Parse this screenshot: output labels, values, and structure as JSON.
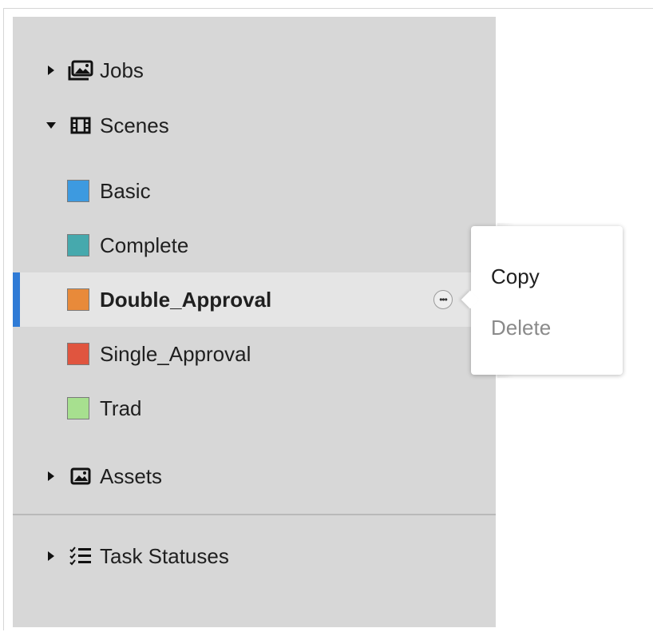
{
  "tree": {
    "jobs": {
      "label": "Jobs",
      "icon": "images-icon",
      "expanded": false
    },
    "scenes": {
      "label": "Scenes",
      "icon": "film-icon",
      "expanded": true,
      "items": [
        {
          "label": "Basic",
          "color": "#3d9ae0",
          "selected": false
        },
        {
          "label": "Complete",
          "color": "#46a9ad",
          "selected": false
        },
        {
          "label": "Double_Approval",
          "color": "#e88a3a",
          "selected": true
        },
        {
          "label": "Single_Approval",
          "color": "#e0553f",
          "selected": false
        },
        {
          "label": "Trad",
          "color": "#a7e08f",
          "selected": false
        }
      ]
    },
    "assets": {
      "label": "Assets",
      "icon": "image-icon",
      "expanded": false
    },
    "task_statuses": {
      "label": "Task Statuses",
      "icon": "checklist-icon",
      "expanded": false
    }
  },
  "context_menu": {
    "items": [
      {
        "label": "Copy",
        "enabled": true
      },
      {
        "label": "Delete",
        "enabled": false
      }
    ]
  },
  "more_button": {
    "glyph": "•••"
  },
  "colors": {
    "sidebar_bg": "#d7d7d7",
    "selected_bg": "#e5e5e5",
    "accent": "#2f7bd6"
  }
}
